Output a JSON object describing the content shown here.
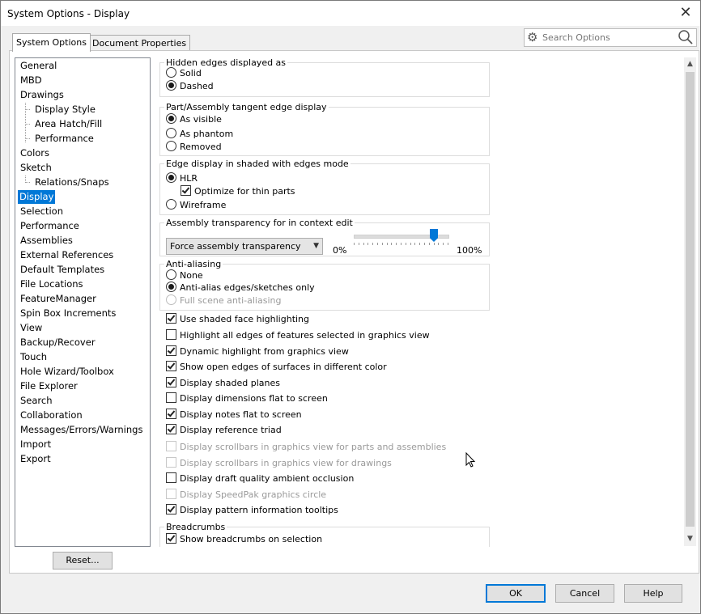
{
  "window": {
    "title": "System Options - Display"
  },
  "tabs": [
    {
      "label": "System Options",
      "active": true
    },
    {
      "label": "Document Properties",
      "active": false
    }
  ],
  "search": {
    "placeholder": "Search Options"
  },
  "tree": {
    "items": [
      {
        "label": "General"
      },
      {
        "label": "MBD"
      },
      {
        "label": "Drawings"
      },
      {
        "label": "Display Style"
      },
      {
        "label": "Area Hatch/Fill"
      },
      {
        "label": "Performance"
      },
      {
        "label": "Colors"
      },
      {
        "label": "Sketch"
      },
      {
        "label": "Relations/Snaps"
      },
      {
        "label": "Display",
        "selected": true
      },
      {
        "label": "Selection"
      },
      {
        "label": "Performance"
      },
      {
        "label": "Assemblies"
      },
      {
        "label": "External References"
      },
      {
        "label": "Default Templates"
      },
      {
        "label": "File Locations"
      },
      {
        "label": "FeatureManager"
      },
      {
        "label": "Spin Box Increments"
      },
      {
        "label": "View"
      },
      {
        "label": "Backup/Recover"
      },
      {
        "label": "Touch"
      },
      {
        "label": "Hole Wizard/Toolbox"
      },
      {
        "label": "File Explorer"
      },
      {
        "label": "Search"
      },
      {
        "label": "Collaboration"
      },
      {
        "label": "Messages/Errors/Warnings"
      },
      {
        "label": "Import"
      },
      {
        "label": "Export"
      }
    ]
  },
  "reset_label": "Reset...",
  "hidden_edges": {
    "title": "Hidden edges displayed as",
    "options": [
      {
        "label": "Solid",
        "selected": false
      },
      {
        "label": "Dashed",
        "selected": true
      }
    ]
  },
  "tangent_edge": {
    "title": "Part/Assembly tangent edge display",
    "options": [
      {
        "label": "As visible",
        "selected": true
      },
      {
        "label": "As phantom",
        "selected": false
      },
      {
        "label": "Removed",
        "selected": false
      }
    ]
  },
  "edge_shaded": {
    "title": "Edge display in shaded with edges mode",
    "hlr": "HLR",
    "optimize": "Optimize for thin parts",
    "wireframe": "Wireframe"
  },
  "assembly_transparency": {
    "title": "Assembly transparency for in context edit",
    "selected": "Force assembly transparency",
    "min_label": "0%",
    "max_label": "100%",
    "value_percent": 85
  },
  "anti_aliasing": {
    "title": "Anti-aliasing",
    "options": [
      {
        "label": "None"
      },
      {
        "label": "Anti-alias edges/sketches only"
      },
      {
        "label": "Full scene anti-aliasing"
      }
    ]
  },
  "checkboxes": [
    {
      "label": "Use shaded face highlighting",
      "checked": true,
      "disabled": false
    },
    {
      "label": "Highlight all edges of features selected in graphics view",
      "checked": false,
      "disabled": false
    },
    {
      "label": "Dynamic highlight from graphics view",
      "checked": true,
      "disabled": false
    },
    {
      "label": "Show open edges of surfaces in different color",
      "checked": true,
      "disabled": false
    },
    {
      "label": "Display shaded planes",
      "checked": true,
      "disabled": false
    },
    {
      "label": "Display dimensions flat to screen",
      "checked": false,
      "disabled": false
    },
    {
      "label": "Display notes flat to screen",
      "checked": true,
      "disabled": false
    },
    {
      "label": "Display reference triad",
      "checked": true,
      "disabled": false
    },
    {
      "label": "Display scrollbars in graphics view for parts and assemblies",
      "checked": false,
      "disabled": true
    },
    {
      "label": "Display scrollbars in graphics view for drawings",
      "checked": false,
      "disabled": true
    },
    {
      "label": "Display draft quality ambient occlusion",
      "checked": false,
      "disabled": false
    },
    {
      "label": "Display SpeedPak graphics circle",
      "checked": false,
      "disabled": true
    },
    {
      "label": "Display pattern information tooltips",
      "checked": true,
      "disabled": false
    }
  ],
  "breadcrumbs": {
    "title": "Breadcrumbs",
    "option": "Show breadcrumbs on selection"
  },
  "buttons": {
    "ok": "OK",
    "cancel": "Cancel",
    "help": "Help"
  }
}
